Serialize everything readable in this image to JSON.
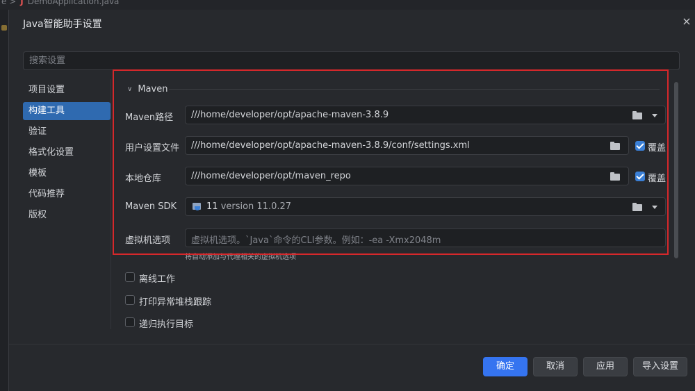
{
  "background": {
    "breadcrumb_sep": "e >",
    "file_icon": "J",
    "file_name": "DemoApplication.java"
  },
  "dialog": {
    "title": "Java智能助手设置",
    "close": "×"
  },
  "search": {
    "placeholder": "搜索设置"
  },
  "nav": {
    "items": [
      {
        "label": "项目设置",
        "active": false
      },
      {
        "label": "构建工具",
        "active": true
      },
      {
        "label": "验证",
        "active": false
      },
      {
        "label": "格式化设置",
        "active": false
      },
      {
        "label": "模板",
        "active": false
      },
      {
        "label": "代码推荐",
        "active": false
      },
      {
        "label": "版权",
        "active": false
      }
    ]
  },
  "maven": {
    "section_title": "Maven",
    "path_label": "Maven路径",
    "path_value": "///home/developer/opt/apache-maven-3.8.9",
    "user_settings_label": "用户设置文件",
    "user_settings_value": "///home/developer/opt/apache-maven-3.8.9/conf/settings.xml",
    "user_settings_override": "覆盖",
    "local_repo_label": "本地仓库",
    "local_repo_value": "///home/developer/opt/maven_repo",
    "local_repo_override": "覆盖",
    "sdk_label": "Maven SDK",
    "sdk_version_num": "11",
    "sdk_version_text": "version 11.0.27",
    "vm_label": "虚拟机选项",
    "vm_placeholder": "虚拟机选项。`Java`命令的CLI参数。例如：-ea -Xmx2048m",
    "vm_hint": "将自动添加与代理相关的虚拟机选项"
  },
  "options": {
    "offline": "离线工作",
    "print_stack": "打印异常堆栈跟踪",
    "recursive": "递归执行目标"
  },
  "buttons": {
    "ok": "确定",
    "cancel": "取消",
    "apply": "应用",
    "import": "导入设置"
  },
  "colors": {
    "accent": "#3574f0",
    "highlight_border": "#d6282b",
    "nav_active": "#2f6ab0"
  }
}
